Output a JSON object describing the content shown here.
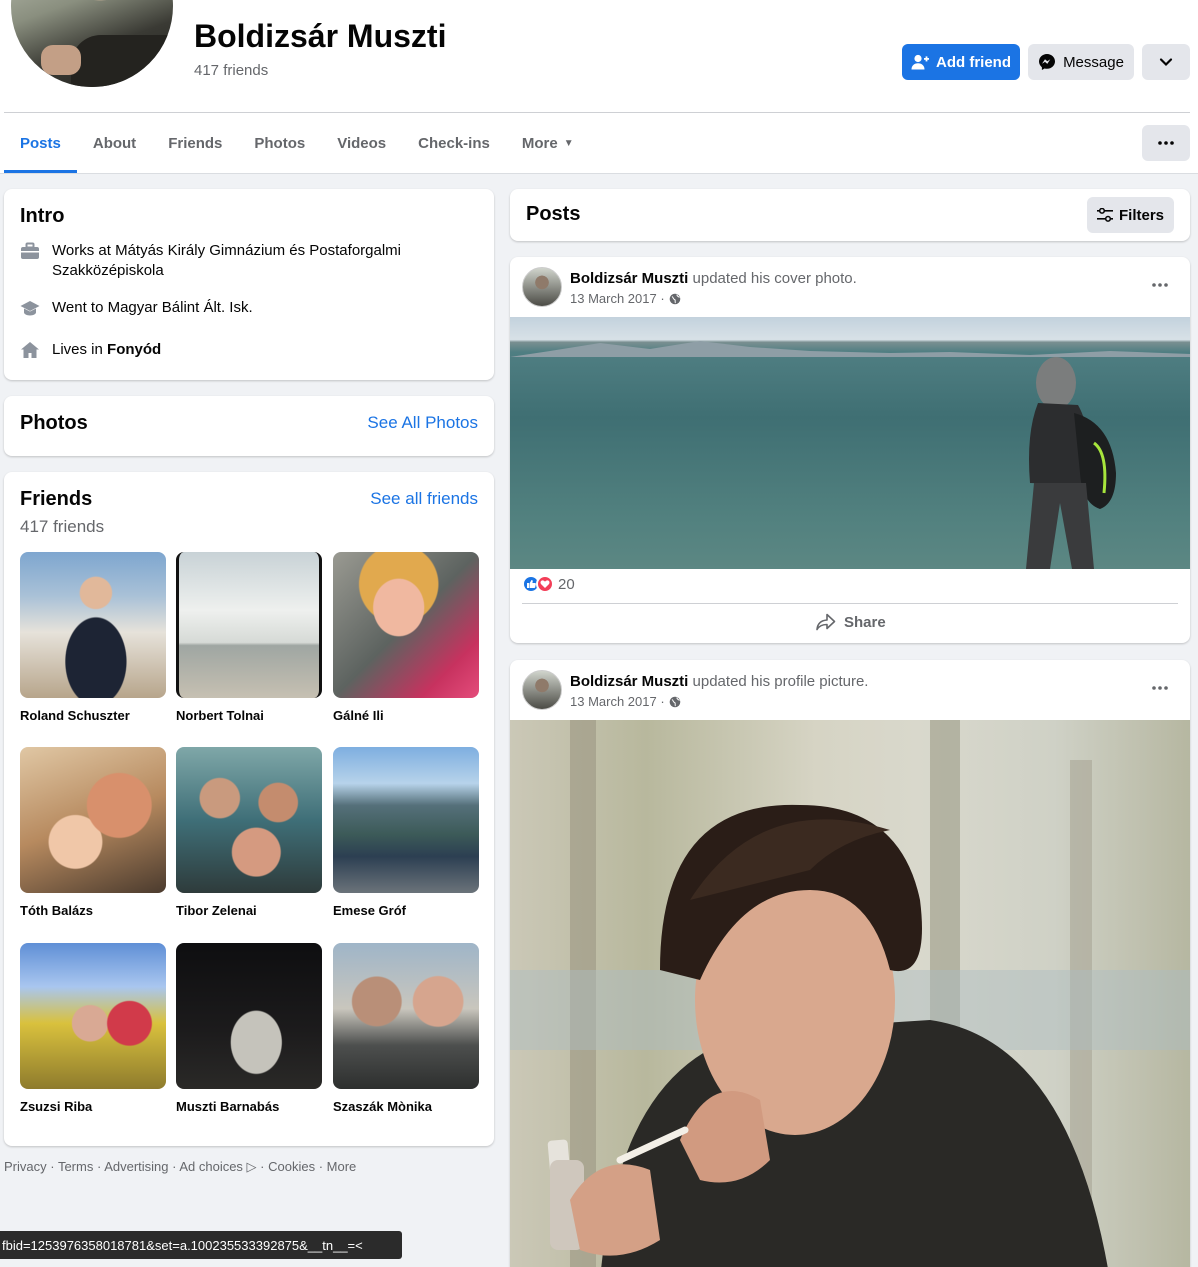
{
  "profile": {
    "name": "Boldizsár Muszti",
    "friend_count": "417 friends",
    "add_friend": "Add friend",
    "message": "Message"
  },
  "tabs": [
    "Posts",
    "About",
    "Friends",
    "Photos",
    "Videos",
    "Check-ins",
    "More"
  ],
  "intro": {
    "title": "Intro",
    "work_prefix": "Works at ",
    "work_place": "Mátyás Király Gimnázium és Postaforgalmi Szakközépiskola",
    "school_prefix": "Went to ",
    "school": "Magyar Bálint Ált. Isk.",
    "lives_prefix": "Lives in ",
    "lives_place": "Fonyód"
  },
  "photos_section": {
    "title": "Photos",
    "link": "See All Photos"
  },
  "friends_section": {
    "title": "Friends",
    "link": "See all friends",
    "count": "417 friends",
    "items": [
      {
        "name": "Roland Schuszter"
      },
      {
        "name": "Norbert Tolnai"
      },
      {
        "name": "Gálné Ili"
      },
      {
        "name": "Tóth Balázs"
      },
      {
        "name": "Tibor Zelenai"
      },
      {
        "name": "Emese Gróf"
      },
      {
        "name": "Zsuzsi Riba"
      },
      {
        "name": "Muszti Barnabás"
      },
      {
        "name": "Szaszák Mònika"
      }
    ]
  },
  "footer": [
    "Privacy",
    "Terms",
    "Advertising",
    "Ad choices",
    "Cookies",
    "More"
  ],
  "status_url": "fbid=1253976358018781&set=a.100235533392875&__tn__=<",
  "posts_header": {
    "title": "Posts",
    "filters": "Filters"
  },
  "posts": [
    {
      "author": "Boldizsár Muszti",
      "action": " updated his cover photo.",
      "date": "13 March 2017 ·",
      "reactions": "20",
      "share": "Share"
    },
    {
      "author": "Boldizsár Muszti",
      "action": " updated his profile picture.",
      "date": "13 March 2017 ·"
    }
  ],
  "colors": {
    "accent": "#1b74e4",
    "background": "#f0f2f5",
    "like": "#1b74e4",
    "love": "#f33e58"
  }
}
